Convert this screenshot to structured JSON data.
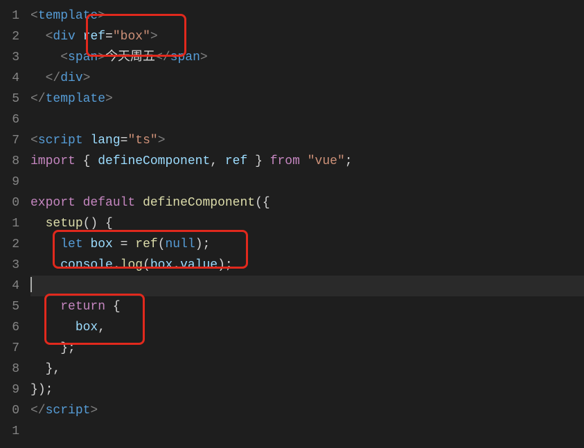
{
  "gutter": [
    "1",
    "2",
    "3",
    "4",
    "5",
    "6",
    "7",
    "8",
    "9",
    "0",
    "1",
    "2",
    "3",
    "4",
    "5",
    "6",
    "7",
    "8",
    "9",
    "0",
    "1"
  ],
  "code": {
    "l1": {
      "open": "<",
      "tag": "template",
      "close": ">"
    },
    "l2": {
      "indent": "  ",
      "open": "<",
      "tag": "div",
      "sp": " ",
      "attr": "ref",
      "eq": "=",
      "q1": "\"",
      "val": "box",
      "q2": "\"",
      "close": ">"
    },
    "l3": {
      "indent": "    ",
      "open": "<",
      "tag": "span",
      "close": ">",
      "text": "今天周五",
      "open2": "</",
      "tag2": "span",
      "close2": ">"
    },
    "l4": {
      "indent": "  ",
      "open": "</",
      "tag": "div",
      "close": ">"
    },
    "l5": {
      "open": "</",
      "tag": "template",
      "close": ">"
    },
    "l6": {
      "blank": ""
    },
    "l7": {
      "open": "<",
      "tag": "script",
      "sp": " ",
      "attr": "lang",
      "eq": "=",
      "q1": "\"",
      "val": "ts",
      "q2": "\"",
      "close": ">"
    },
    "l8": {
      "kw": "import",
      "sp": " ",
      "brace1": "{ ",
      "id1": "defineComponent",
      "comma": ", ",
      "id2": "ref",
      "brace2": " }",
      "sp2": " ",
      "kw2": "from",
      "sp3": " ",
      "str": "\"vue\"",
      "semi": ";"
    },
    "l9": {
      "blank": ""
    },
    "l10": {
      "kw1": "export",
      "sp": " ",
      "kw2": "default",
      "sp2": " ",
      "fn": "defineComponent",
      "paren": "(",
      "brace": "{"
    },
    "l11": {
      "indent": "  ",
      "fn": "setup",
      "args": "()",
      "sp": " ",
      "brace": "{"
    },
    "l12": {
      "indent": "    ",
      "kw": "let",
      "sp": " ",
      "id": "box",
      "sp2": " ",
      "eq": "=",
      "sp3": " ",
      "fn": "ref",
      "paren1": "(",
      "null": "null",
      "paren2": ")",
      "semi": ";"
    },
    "l13": {
      "indent": "    ",
      "obj": "console",
      "dot": ".",
      "fn": "log",
      "paren1": "(",
      "id": "box",
      "dot2": ".",
      "prop": "value",
      "paren2": ")",
      "semi": ";"
    },
    "l14": {
      "blank": ""
    },
    "l15": {
      "indent": "    ",
      "kw": "return",
      "sp": " ",
      "brace": "{"
    },
    "l16": {
      "indent": "      ",
      "id": "box",
      "comma": ","
    },
    "l17": {
      "indent": "    ",
      "brace": "}",
      "semi": ";"
    },
    "l18": {
      "indent": "  ",
      "brace": "}",
      "comma": ","
    },
    "l19": {
      "brace": "}",
      "paren": ")",
      "semi": ";"
    },
    "l20": {
      "open": "</",
      "tag": "script",
      "close": ">"
    },
    "l21": {
      "blank": ""
    }
  }
}
